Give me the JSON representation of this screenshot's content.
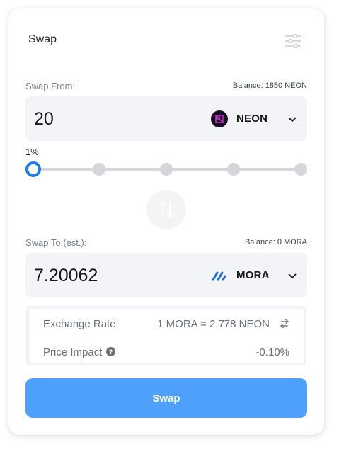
{
  "header": {
    "title": "Swap",
    "settings_icon": "settings-sliders-icon"
  },
  "from": {
    "label": "Swap From:",
    "balance": "Balance: 1850 NEON",
    "amount": "20",
    "token": {
      "symbol": "NEON",
      "icon": "neon-token-icon"
    }
  },
  "slider": {
    "label": "1%",
    "stops": 5,
    "selected_index": 0,
    "accent_color": "#1f79e8"
  },
  "to": {
    "label": "Swap To (est.):",
    "balance": "Balance: 0 MORA",
    "amount": "7.20062",
    "token": {
      "symbol": "MORA",
      "icon": "mora-token-icon"
    }
  },
  "details": {
    "exchange_rate_label": "Exchange Rate",
    "exchange_rate_value": "1 MORA = 2.778 NEON",
    "price_impact_label": "Price Impact",
    "price_impact_value": "-0.10%"
  },
  "action": {
    "swap_label": "Swap",
    "color": "#4fa0fb"
  }
}
